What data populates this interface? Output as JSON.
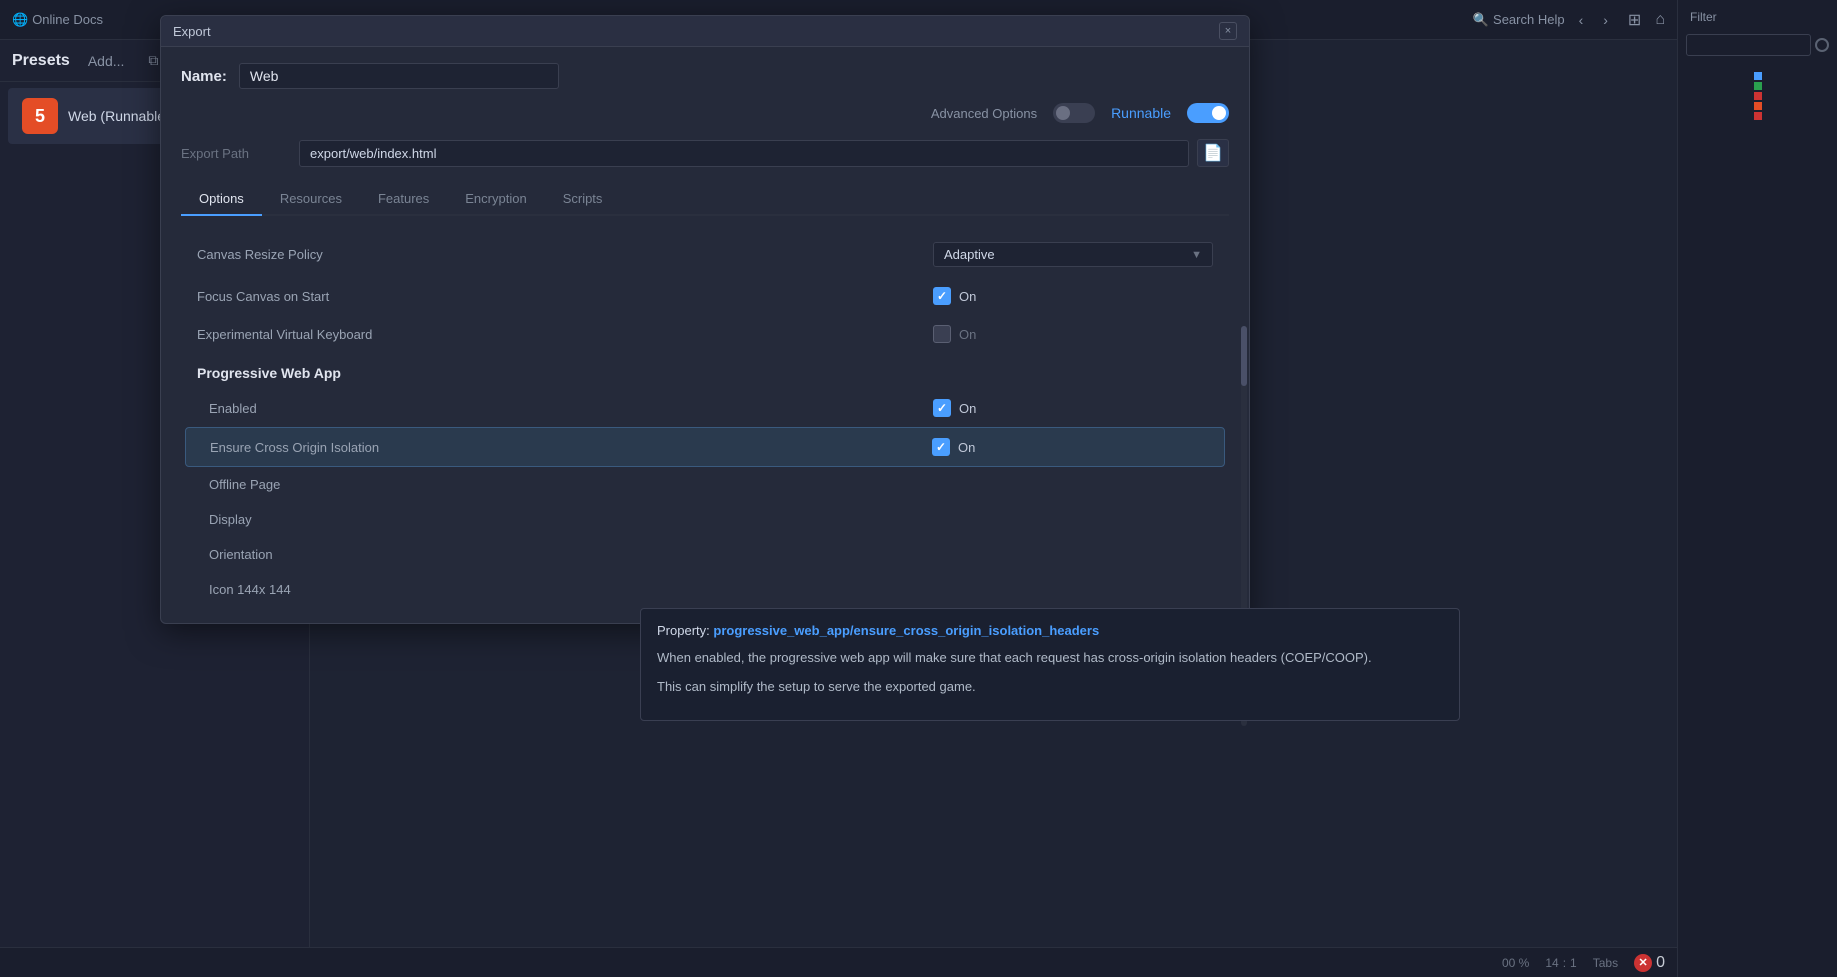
{
  "dialog": {
    "title": "Export",
    "close_label": "×"
  },
  "name_field": {
    "label": "Name:",
    "value": "Web"
  },
  "advanced": {
    "label": "Advanced Options",
    "runnable_label": "Runnable"
  },
  "export_path": {
    "label": "Export Path",
    "value": "export/web/index.html"
  },
  "tabs": [
    {
      "label": "Options",
      "active": true
    },
    {
      "label": "Resources",
      "active": false
    },
    {
      "label": "Features",
      "active": false
    },
    {
      "label": "Encryption",
      "active": false
    },
    {
      "label": "Scripts",
      "active": false
    }
  ],
  "options": {
    "canvas_resize_policy": {
      "label": "Canvas Resize Policy",
      "value": "Adaptive"
    },
    "focus_canvas_on_start": {
      "label": "Focus Canvas on Start",
      "on_label": "On"
    },
    "experimental_virtual_keyboard": {
      "label": "Experimental Virtual Keyboard",
      "on_label": "On"
    },
    "pwa_section": "Progressive Web App",
    "pwa_enabled": {
      "label": "Enabled",
      "on_label": "On"
    },
    "ensure_cross_origin": {
      "label": "Ensure Cross Origin Isolation",
      "on_label": "On"
    },
    "offline_page": {
      "label": "Offline Page"
    },
    "display": {
      "label": "Display"
    },
    "orientation": {
      "label": "Orientation"
    },
    "icon": {
      "label": "Icon 144x 144"
    }
  },
  "tooltip": {
    "property_label": "Property:",
    "property_value": "progressive_web_app/ensure_cross_origin_isolation_headers",
    "text1": "When enabled, the progressive web app will make sure that each request has cross-origin isolation headers (COEP/COOP).",
    "text2": "This can simplify the setup to serve the exported game."
  },
  "sidebar": {
    "presets_label": "Presets",
    "add_label": "Add...",
    "preset_items": [
      {
        "label": "Web (Runnable)"
      }
    ]
  },
  "topbar": {
    "online_docs": "Online Docs",
    "search_help": "Search Help",
    "filter_label": "Filter"
  },
  "status_bar": {
    "zoom": "00 %",
    "col": "14",
    "row": "1",
    "tabs_label": "Tabs"
  },
  "error_count": "0"
}
